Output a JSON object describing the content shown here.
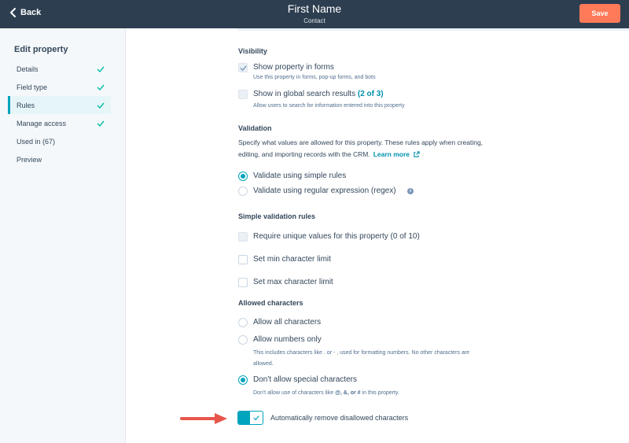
{
  "header": {
    "back_label": "Back",
    "title": "First Name",
    "subtitle": "Contact",
    "save_label": "Save"
  },
  "sidebar": {
    "heading": "Edit property",
    "items": [
      {
        "label": "Details",
        "completed": true
      },
      {
        "label": "Field type",
        "completed": true
      },
      {
        "label": "Rules",
        "completed": true,
        "active": true
      },
      {
        "label": "Manage access",
        "completed": true
      },
      {
        "label": "Used in (67)",
        "completed": false
      },
      {
        "label": "Preview",
        "completed": false
      }
    ]
  },
  "visibility": {
    "title": "Visibility",
    "show_in_forms": {
      "label": "Show property in forms",
      "help": "Use this property in forms, pop-up forms, and bots",
      "checked": true,
      "disabled": true
    },
    "global_search": {
      "label": "Show in global search results",
      "count": "(2 of 3)",
      "help": "Allow users to search for information entered into this property",
      "checked": false,
      "disabled": true
    }
  },
  "validation": {
    "title": "Validation",
    "description_line1": "Specify what values are allowed for this property. These rules apply when creating,",
    "description_line2": "editing, and importing records with the CRM.",
    "learn_more": "Learn more",
    "options": [
      {
        "label": "Validate using simple rules",
        "selected": true
      },
      {
        "label": "Validate using regular expression (regex)",
        "selected": false
      }
    ]
  },
  "simple_rules": {
    "title": "Simple validation rules",
    "unique": {
      "label": "Require unique values for this property (0 of 10)",
      "checked": false,
      "disabled": true
    },
    "min_chars": {
      "label": "Set min character limit",
      "checked": false
    },
    "max_chars": {
      "label": "Set max character limit",
      "checked": false
    }
  },
  "allowed_characters": {
    "title": "Allowed characters",
    "all": {
      "label": "Allow all characters",
      "selected": false
    },
    "numbers": {
      "label": "Allow numbers only",
      "help_line1": "This includes characters like . or - , used for formatting numbers. No other characters are",
      "help_line2": "allowed.",
      "selected": false
    },
    "no_special": {
      "label": "Don't allow special characters",
      "help_before": "Don't allow use of characters like ",
      "help_chars": "@, &, or #",
      "help_after": " in this property.",
      "selected": true
    },
    "auto_remove": {
      "label": "Automatically remove disallowed characters",
      "enabled": true
    }
  },
  "colors": {
    "header_bg": "#2d3e50",
    "save_button": "#ff7a59",
    "accent": "#00a4bd",
    "sidebar_bg": "#f5f8fa",
    "check_green": "#00bda5",
    "arrow_red": "#e8564b"
  }
}
